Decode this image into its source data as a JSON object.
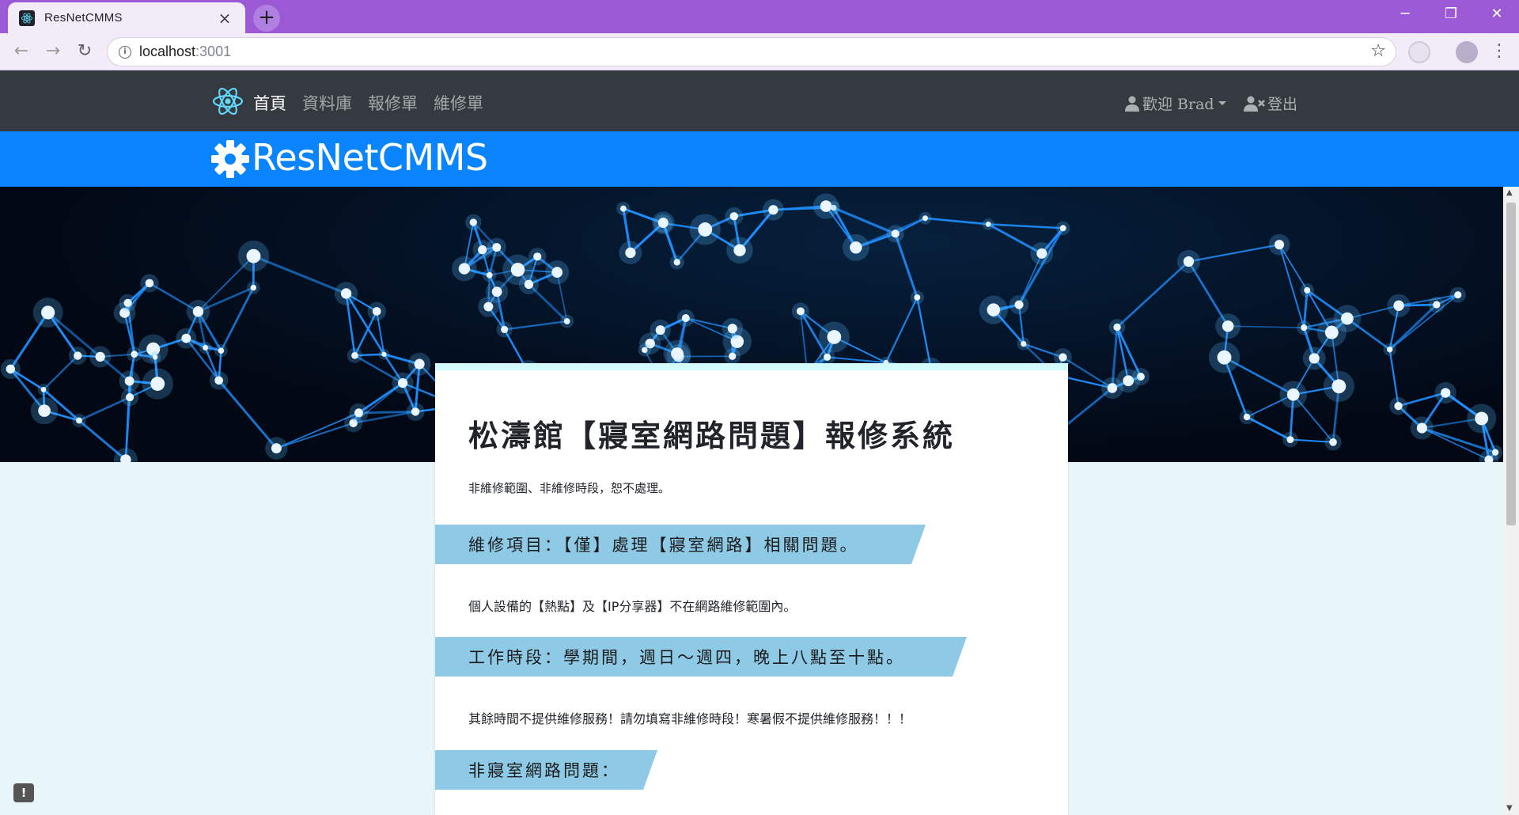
{
  "browser": {
    "tab_title": "ResNetCMMS",
    "url_host": "localhost",
    "url_port": ":3001",
    "new_tab_symbol": "+",
    "close_symbol": "×",
    "minimize_symbol": "─",
    "restore_symbol": "❐",
    "window_close_symbol": "✕",
    "back_symbol": "←",
    "forward_symbol": "→",
    "reload_symbol": "↻",
    "bookmark_symbol": "☆",
    "menu_symbol": "⋮"
  },
  "nav": {
    "links": [
      "首頁",
      "資料庫",
      "報修單",
      "維修單"
    ],
    "user_greeting": "歡迎 Brad",
    "logout": "登出",
    "colors": {
      "bar": "#343a40",
      "brand": "#0a84ff"
    }
  },
  "brand": {
    "title": "ResNetCMMS"
  },
  "card": {
    "title": "松濤館【寢室網路問題】報修系統",
    "notice": "非維修範圍、非維修時段，恕不處理。",
    "sections": [
      {
        "heading": "維修項目：【僅】處理【寢室網路】相關問題。",
        "text": "個人設備的【熱點】及【IP分享器】不在網路維修範圍內。"
      },
      {
        "heading": "工作時段：學期間，週日～週四，晚上八點至十點。",
        "text": "其餘時間不提供維修服務！請勿填寫非維修時段！寒暑假不提供維修服務！！！"
      },
      {
        "heading": "非寢室網路問題：",
        "text": ""
      }
    ]
  },
  "feedback_symbol": "!"
}
